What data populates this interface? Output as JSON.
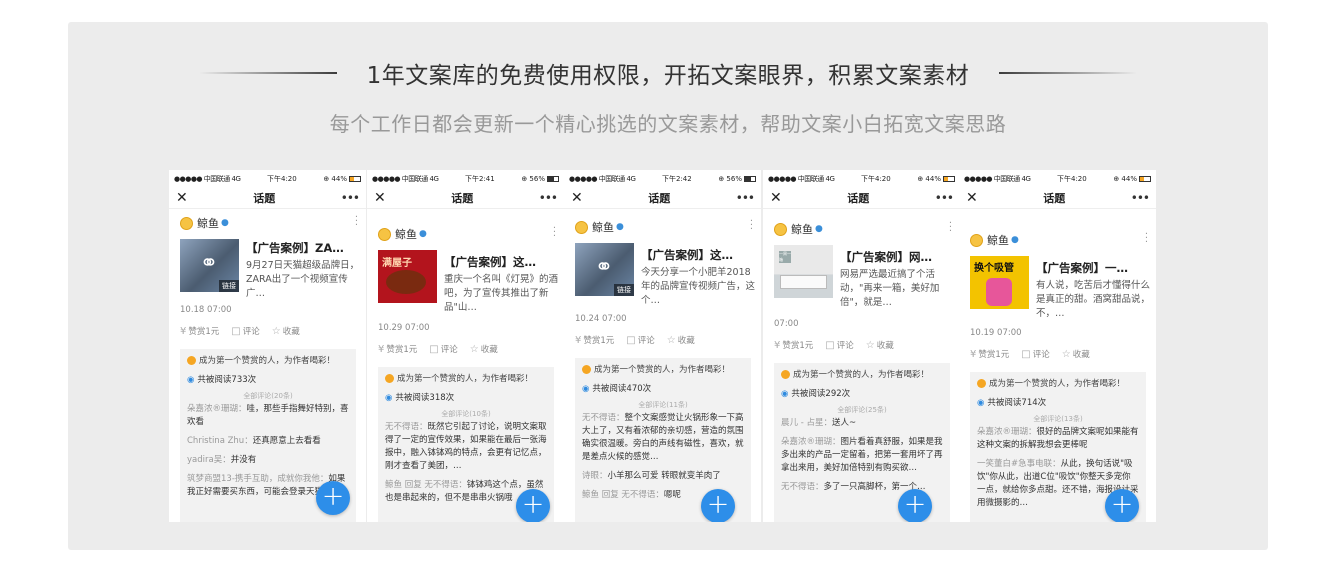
{
  "header": {
    "title": "1年文案库的免费使用权限，开拓文案眼界，积累文案素材",
    "subtitle": "每个工作日都会更新一个精心挑选的文案素材，帮助文案小白拓宽文案思路"
  },
  "phones": [
    {
      "status": {
        "carrier": "●●●●● 中国联通  4G",
        "time": "下午4:20",
        "battery": "⊕ 44%"
      },
      "nav": {
        "close": "✕",
        "title": "话题",
        "more": "•••"
      },
      "author": "鲸鱼",
      "thumb_tag": "链接",
      "card_title": "【广告案例】ZA…",
      "card_desc": "9月27日天猫超级品牌日，ZARA出了一个视频宣传广…",
      "date": "10.18 07:00",
      "actions": {
        "reward": "赞赏1元",
        "comment": "评论",
        "fav": "收藏"
      },
      "praise": "成为第一个赞赏的人，为作者喝彩！",
      "reads": "共被阅读733次",
      "comments_header": "全部评论(20条)",
      "comments": [
        {
          "name": "朵嘉浓®珊瑚：",
          "text": "哇，那些手指舞好特别，喜欢看"
        },
        {
          "name": "Christina Zhu：",
          "text": "还真愿意上去看看"
        },
        {
          "name": "yadira吴：",
          "text": "并没有"
        },
        {
          "name": "筑梦商盟13-携手互助，成就你我他：",
          "text": "如果我正好需要买东西，可能会登录天猫"
        }
      ]
    },
    {
      "status": {
        "carrier": "●●●●● 中国联通  4G",
        "time": "下午2:41",
        "battery": "⊕ 56%"
      },
      "nav": {
        "close": "✕",
        "title": "话题",
        "more": "•••"
      },
      "author": "鲸鱼",
      "thumb_tag": "",
      "thumb_text": "满屋子",
      "card_title": "【广告案例】这…",
      "card_desc": "重庆一个名叫《灯晃》的酒吧，为了宣传其推出了新品\"山…",
      "date": "10.29 07:00",
      "actions": {
        "reward": "赞赏1元",
        "comment": "评论",
        "fav": "收藏"
      },
      "praise": "成为第一个赞赏的人，为作者喝彩！",
      "reads": "共被阅读318次",
      "comments_header": "全部评论(10条)",
      "comments": [
        {
          "name": "无不得语：",
          "text": "既然它引起了讨论，说明文案取得了一定的宣传效果，如果能在最后一张海报中，融入钵钵鸡的特点，会更有记忆点，刚才查看了美团，…"
        },
        {
          "name": "鲸鱼 回复 无不得语：",
          "text": "钵钵鸡这个点，虽然也是串起来的，但不是串串火锅哦"
        }
      ]
    },
    {
      "status": {
        "carrier": "●●●●● 中国联通  4G",
        "time": "下午2:42",
        "battery": "⊕ 56%"
      },
      "nav": {
        "close": "✕",
        "title": "话题",
        "more": "•••"
      },
      "author": "鲸鱼",
      "thumb_tag": "链接",
      "card_title": "【广告案例】这…",
      "card_desc": "今天分享一个小肥羊2018年的品牌宣传视频广告，这个…",
      "date": "10.24 07:00",
      "actions": {
        "reward": "赞赏1元",
        "comment": "评论",
        "fav": "收藏"
      },
      "praise": "成为第一个赞赏的人，为作者喝彩！",
      "reads": "共被阅读470次",
      "comments_header": "全部评论(11条)",
      "comments": [
        {
          "name": "无不得语：",
          "text": "整个文案感觉让火锅形象一下高大上了，又有着浓郁的亲切感，营造的氛围确实很温暖。旁白的声线有磁性，喜欢，就是差点火候的感觉…"
        },
        {
          "name": "诗眼：",
          "text": "小羊那么可爱 转眼就变羊肉了"
        },
        {
          "name": "鲸鱼 回复 无不得语：",
          "text": "嗯呢"
        }
      ]
    },
    {
      "status": {
        "carrier": "●●●●● 中国联通  4G",
        "time": "下午4:20",
        "battery": "⊕ 44%"
      },
      "nav": {
        "close": "✕",
        "title": "话题",
        "more": "•••"
      },
      "author": "鲸鱼",
      "thumb_tag": "",
      "thumb_text": "一周一箱",
      "card_title": "【广告案例】网…",
      "card_desc": "网易严选最近搞了个活动，\"再来一箱，美好加倍\"，就是…",
      "date": "07:00",
      "actions": {
        "reward": "赞赏1元",
        "comment": "评论",
        "fav": "收藏"
      },
      "praise": "成为第一个赞赏的人，为作者喝彩！",
      "reads": "共被阅读292次",
      "comments_header": "全部评论(25条)",
      "comments": [
        {
          "name": "晨儿 - 占星：",
          "text": "送人~"
        },
        {
          "name": "朵嘉浓®珊瑚：",
          "text": "图片看着真舒服，如果是我多出来的产品一定留着，把第一套用坏了再拿出来用，美好加倍特别有购买欲…"
        },
        {
          "name": "无不得语：",
          "text": "多了一只高脚杯，第一个…"
        }
      ]
    },
    {
      "status": {
        "carrier": "●●●●● 中国联通  4G",
        "time": "下午4:20",
        "battery": "⊕ 44%"
      },
      "nav": {
        "close": "✕",
        "title": "话题",
        "more": "•••"
      },
      "author": "鲸鱼",
      "thumb_tag": "",
      "thumb_text": "换个吸管",
      "card_title": "【广告案例】一…",
      "card_desc": "有人说，吃苦后才懂得什么是真正的甜。酒窝甜品说，不，…",
      "date": "10.19 07:00",
      "actions": {
        "reward": "赞赏1元",
        "comment": "评论",
        "fav": "收藏"
      },
      "praise": "成为第一个赞赏的人，为作者喝彩！",
      "reads": "共被阅读714次",
      "comments_header": "全部评论(13条)",
      "comments": [
        {
          "name": "朵嘉浓®珊瑚：",
          "text": "很好的品牌文案呢如果能有这种文案的拆解我想会更棒呢"
        },
        {
          "name": "一笑董白#急事电联：",
          "text": "从此，换句话说\"吸饮\"你从此，出道C位\"吸饮\"你整天多宠你一点，就给你多点甜。还不错，海报设计采用微摄影的…"
        }
      ]
    }
  ],
  "fab_label": "+",
  "icons": {
    "author_avatar": "yellow-circle-avatar",
    "whale": "whale-icon",
    "link": "link-chain-icon",
    "reward": "yen-icon",
    "comment": "comment-icon",
    "fav": "star-icon",
    "eye": "eye-icon",
    "add": "plus-icon"
  },
  "colors": {
    "accent": "#2d8ee9",
    "panel_bg": "#ececec",
    "praise_coin": "#f5a623"
  }
}
